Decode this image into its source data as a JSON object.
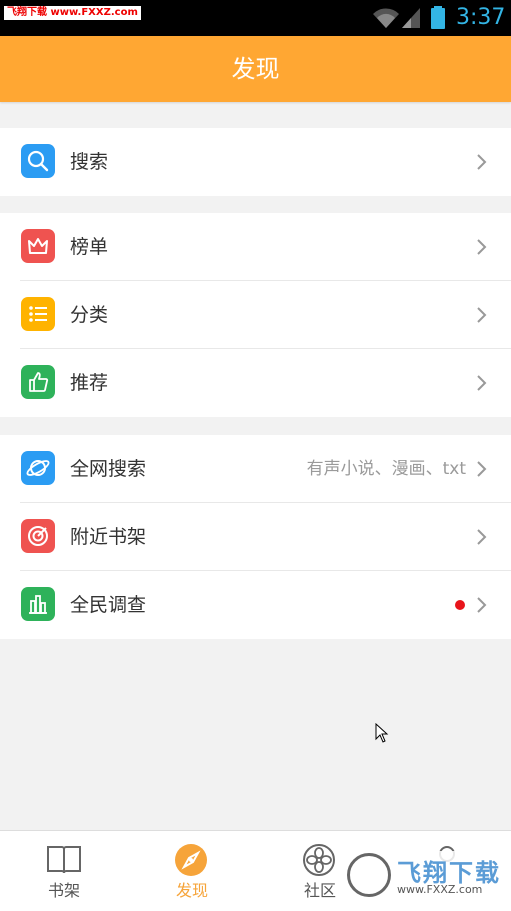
{
  "status_bar": {
    "watermark": "飞翔下载 www.FXXZ.com",
    "time": "3:37"
  },
  "header": {
    "title": "发现"
  },
  "groups": [
    {
      "items": [
        {
          "label": "搜索",
          "icon": "search-icon",
          "color": "#2b9cf3"
        }
      ]
    },
    {
      "items": [
        {
          "label": "榜单",
          "icon": "crown-icon",
          "color": "#ef5350"
        },
        {
          "label": "分类",
          "icon": "list-icon",
          "color": "#ffb300"
        },
        {
          "label": "推荐",
          "icon": "thumbs-up-icon",
          "color": "#2eb25a"
        }
      ]
    },
    {
      "items": [
        {
          "label": "全网搜索",
          "sub": "有声小说、漫画、txt",
          "icon": "planet-icon",
          "color": "#2b9cf3"
        },
        {
          "label": "附近书架",
          "icon": "radar-icon",
          "color": "#ef5350"
        },
        {
          "label": "全民调查",
          "icon": "bar-chart-icon",
          "color": "#2eb25a",
          "badge": "red-dot"
        }
      ]
    }
  ],
  "tabbar": {
    "active_color": "#f6a43a",
    "tabs": [
      {
        "label": "书架",
        "icon": "book-icon"
      },
      {
        "label": "发现",
        "icon": "compass-icon",
        "active": true
      },
      {
        "label": "社区",
        "icon": "flower-icon"
      },
      {
        "label": "",
        "icon": "person-icon"
      }
    ]
  },
  "watermark": {
    "title": "飞翔下载",
    "url": "www.FXXZ.com"
  }
}
